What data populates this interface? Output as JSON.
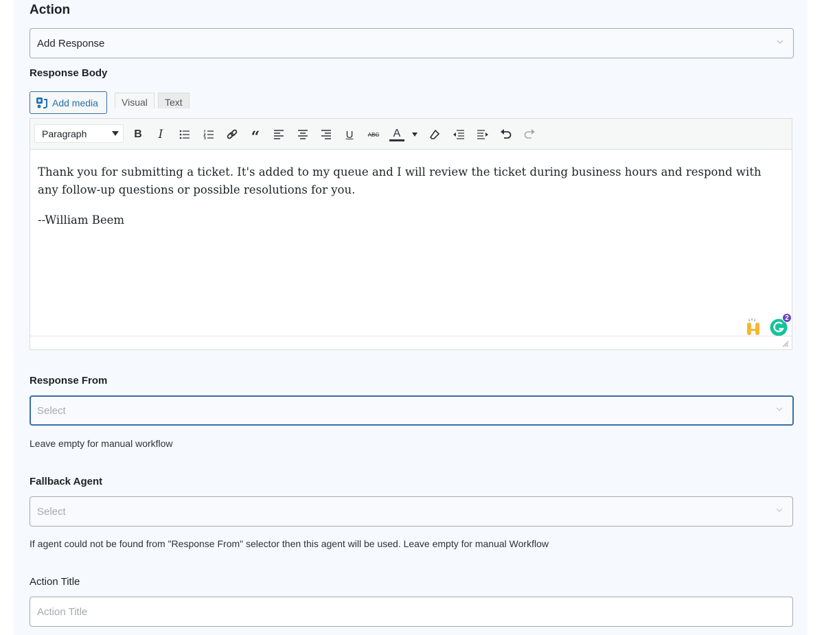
{
  "action": {
    "heading": "Action",
    "selected": "Add Response"
  },
  "response_body": {
    "label": "Response Body",
    "add_media_label": "Add media",
    "tabs": [
      {
        "label": "Visual",
        "active": true
      },
      {
        "label": "Text",
        "active": false
      }
    ],
    "toolbar": {
      "format_select": "Paragraph",
      "buttons": [
        {
          "name": "bold",
          "glyph": "B"
        },
        {
          "name": "italic",
          "glyph": "I"
        },
        {
          "name": "bulleted-list",
          "glyph": "≔"
        },
        {
          "name": "numbered-list",
          "glyph": "⒈"
        },
        {
          "name": "link",
          "glyph": "🔗"
        },
        {
          "name": "blockquote",
          "glyph": "❝"
        },
        {
          "name": "align-left",
          "glyph": "≡"
        },
        {
          "name": "align-center",
          "glyph": "≡"
        },
        {
          "name": "align-right",
          "glyph": "≡"
        },
        {
          "name": "underline",
          "glyph": "U"
        },
        {
          "name": "strikethrough",
          "glyph": "ABC"
        },
        {
          "name": "text-color",
          "glyph": "A"
        },
        {
          "name": "clear-formatting",
          "glyph": "⌫"
        },
        {
          "name": "outdent",
          "glyph": "⇤"
        },
        {
          "name": "indent",
          "glyph": "⇥"
        },
        {
          "name": "undo",
          "glyph": "↶"
        },
        {
          "name": "redo",
          "glyph": "↷"
        }
      ]
    },
    "content": {
      "paragraph_1": "Thank you for submitting a ticket. It's added to my queue and I will review the ticket during business hours and respond with any follow-up questions or possible resolutions for you.",
      "paragraph_2": "--William Beem"
    },
    "grammarly_badge_count": "2"
  },
  "response_from": {
    "label": "Response From",
    "placeholder": "Select",
    "help": "Leave empty for manual workflow"
  },
  "fallback_agent": {
    "label": "Fallback Agent",
    "placeholder": "Select",
    "help": "If agent could not be found from \"Response From\" selector then this agent will be used. Leave empty for manual Workflow"
  },
  "action_title": {
    "label": "Action Title",
    "placeholder": "Action Title"
  },
  "colors": {
    "panel_bg": "#f6f9fd",
    "accent": "#2271b1",
    "focus_border": "#3a6ea5",
    "grammarly_green": "#15c39a",
    "grammarly_badge": "#6b46c1"
  }
}
